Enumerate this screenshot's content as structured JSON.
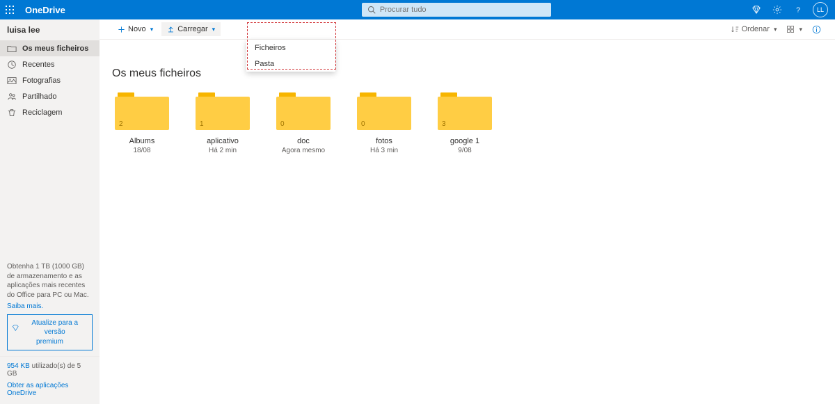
{
  "header": {
    "brand": "OneDrive",
    "search_placeholder": "Procurar tudo",
    "avatar_initials": "LL"
  },
  "sidebar": {
    "user": "luisa lee",
    "items": [
      {
        "label": "Os meus ficheiros",
        "active": true
      },
      {
        "label": "Recentes"
      },
      {
        "label": "Fotografias"
      },
      {
        "label": "Partilhado"
      },
      {
        "label": "Reciclagem"
      }
    ],
    "promo_text": "Obtenha 1 TB (1000 GB) de armazenamento e as aplicações mais recentes do Office para PC ou Mac.",
    "promo_link": "Saiba mais.",
    "premium_line1": "Atualize para a versão",
    "premium_line2": "premium",
    "storage_used": "954 KB",
    "storage_text": " utilizado(s) de 5 GB",
    "get_apps": "Obter as aplicações OneDrive"
  },
  "toolbar": {
    "new_label": "Novo",
    "upload_label": "Carregar",
    "sort_label": "Ordenar",
    "dropdown": [
      "Ficheiros",
      "Pasta"
    ]
  },
  "main": {
    "title": "Os meus ficheiros",
    "folders": [
      {
        "name": "Albums",
        "meta": "18/08",
        "count": "2"
      },
      {
        "name": "aplicativo",
        "meta": "Há 2 min",
        "count": "1"
      },
      {
        "name": "doc",
        "meta": "Agora mesmo",
        "count": "0"
      },
      {
        "name": "fotos",
        "meta": "Há 3 min",
        "count": "0"
      },
      {
        "name": "google 1",
        "meta": "9/08",
        "count": "3"
      }
    ]
  }
}
